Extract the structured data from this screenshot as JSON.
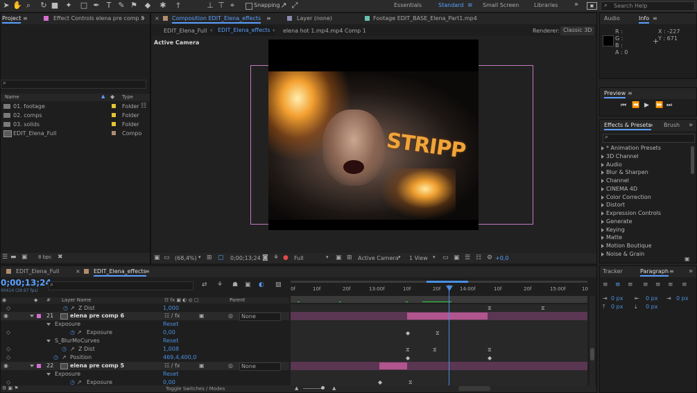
{
  "toolbar": {
    "snapping_label": "Snapping",
    "workspaces": [
      "Essentials",
      "Standard",
      "Small Screen",
      "Libraries"
    ],
    "active_workspace": "Standard",
    "search_placeholder": "Search Help"
  },
  "project_panel": {
    "tab_label": "Project",
    "effect_controls_tab": "Effect Controls elena pre comp 5",
    "search_placeholder": "",
    "columns": {
      "name": "Name",
      "type": "Type"
    },
    "items": [
      {
        "name": "01. footage",
        "type": "Folder"
      },
      {
        "name": "02. comps",
        "type": "Folder"
      },
      {
        "name": "03. solids",
        "type": "Folder"
      },
      {
        "name": "EDIT_Elena_Full",
        "type": "Compo"
      }
    ],
    "bpc": "8 bpc"
  },
  "comp_panel": {
    "tab_composition": "Composition EDIT_Elena_effects",
    "tab_layer": "Layer (none)",
    "tab_footage": "Footage EDIT_BASE_Elena_Part1.mp4",
    "breadcrumb": [
      "EDIT_Elena_Full",
      "EDIT_Elena_effects",
      "elena hot 1.mp4.mp4 Comp 1"
    ],
    "renderer_label": "Renderer:",
    "renderer_value": "Classic 3D",
    "view_label": "Active Camera",
    "overlay_text": "STRIPP",
    "bottom": {
      "zoom": "(68,4%)",
      "timecode": "0;00;13;24",
      "resolution": "Full",
      "camera": "Active Camera",
      "views": "1 View",
      "exposure": "+0,0"
    }
  },
  "audio_info": {
    "audio_tab": "Audio",
    "info_tab": "Info",
    "r": "R :",
    "g": "G :",
    "b": "B :",
    "a": "A :  0",
    "x": "X : -227",
    "y": "Y : 671"
  },
  "preview": {
    "tab": "Preview"
  },
  "effects": {
    "tab": "Effects & Presets",
    "brush_tab": "Brush",
    "items": [
      "* Animation Presets",
      "3D Channel",
      "Audio",
      "Blur & Sharpen",
      "Channel",
      "CINEMA 4D",
      "Color Correction",
      "Distort",
      "Expression Controls",
      "Generate",
      "Keying",
      "Matte",
      "Motion Boutique",
      "Noise & Grain"
    ]
  },
  "timeline": {
    "tabs": [
      "EDIT_Elena_Full",
      "EDIT_Elena_effects"
    ],
    "timecode": "0;00;13;24",
    "fps_label": "00414 (29.97 fps)",
    "columns": {
      "num": "#",
      "layer_name": "Layer Name",
      "parent": "Parent"
    },
    "ruler": [
      "0f",
      "10f",
      "20f",
      "13:00f",
      "10f",
      "20f",
      "14:00f",
      "10f",
      "20f",
      "15:00f",
      "10"
    ],
    "rows": [
      {
        "label": "Z Dist",
        "value": "1,000",
        "indent": 2
      },
      {
        "num": "21",
        "label": "elena pre comp 6",
        "parent": "None",
        "is_layer": true
      },
      {
        "label": "Exposure",
        "value": "Reset",
        "indent": 1
      },
      {
        "label": "Exposure",
        "value": "0,00",
        "indent": 2
      },
      {
        "label": "S_BlurMoCurves",
        "value": "Reset",
        "indent": 1
      },
      {
        "label": "Z Dist",
        "value": "1,008",
        "indent": 2
      },
      {
        "label": "Position",
        "value": "469,4,400,0",
        "indent": 2
      },
      {
        "num": "22",
        "label": "elena pre comp 5",
        "parent": "None",
        "is_layer": true
      },
      {
        "label": "Exposure",
        "value": "Reset",
        "indent": 1
      },
      {
        "label": "Exposure",
        "value": "0,00",
        "indent": 2
      }
    ],
    "toggle_label": "Toggle Switches / Modes"
  },
  "paragraph": {
    "tracker_tab": "Tracker",
    "paragraph_tab": "Paragraph",
    "values": [
      "0 px",
      "0 px",
      "0 px",
      "0 px",
      "0 px"
    ]
  },
  "colors": {
    "accent": "#5aa0ff",
    "layer_bar": "#b0558e",
    "playhead": "#4a90e2"
  }
}
